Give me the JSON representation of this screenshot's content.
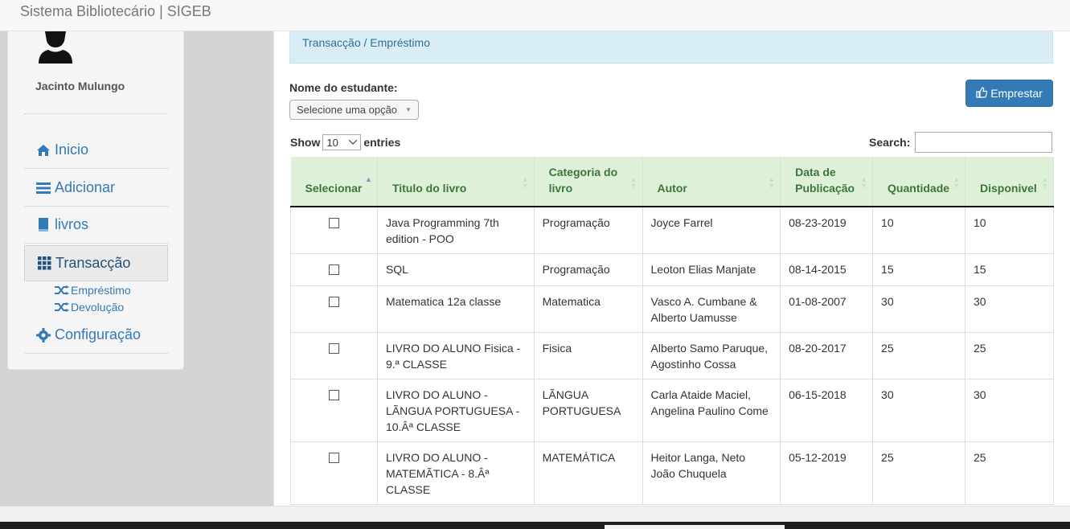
{
  "app": {
    "title": "Sistema Bibliotecário | SIGEB"
  },
  "sidebar": {
    "user_name": "Jacinto Mulungo",
    "items": [
      {
        "label": "Inicio",
        "icon": "home-icon"
      },
      {
        "label": "Adicionar",
        "icon": "list-icon"
      },
      {
        "label": "livros",
        "icon": "book-icon"
      },
      {
        "label": "Transacção",
        "icon": "grid-icon",
        "active": true
      },
      {
        "label": "Configuração",
        "icon": "gear-icon"
      }
    ],
    "sub_items": [
      {
        "label": "Empréstimo",
        "icon": "shuffle-icon"
      },
      {
        "label": "Devolução",
        "icon": "shuffle-icon"
      }
    ]
  },
  "breadcrumb": "Transacção / Empréstimo",
  "form": {
    "student_label": "Nome do estudante:",
    "student_placeholder": "Selecione uma opção",
    "lend_button": "Emprestar"
  },
  "table_controls": {
    "show_label": "Show",
    "entries_value": "10",
    "entries_label": "entries",
    "search_label": "Search:"
  },
  "table": {
    "headers": [
      "Selecionar",
      "Titulo do livro",
      "Categoria do livro",
      "Autor",
      "Data de Publicação",
      "Quantidade",
      "Disponivel"
    ],
    "rows": [
      {
        "title": "Java Programming 7th edition - POO",
        "category": "Programação",
        "author": "Joyce Farrel",
        "date": "08-23-2019",
        "quantity": "10",
        "available": "10"
      },
      {
        "title": "SQL",
        "category": "Programação",
        "author": "Leoton Elias Manjate",
        "date": "08-14-2015",
        "quantity": "15",
        "available": "15"
      },
      {
        "title": "Matematica 12a classe",
        "category": "Matematica",
        "author": "Vasco A. Cumbane & Alberto Uamusse",
        "date": "01-08-2007",
        "quantity": "30",
        "available": "30"
      },
      {
        "title": "LIVRO DO ALUNO Fisica - 9.ª CLASSE",
        "category": "Fisica",
        "author": "Alberto Samo Paruque, Agostinho Cossa",
        "date": "08-20-2017",
        "quantity": "25",
        "available": "25"
      },
      {
        "title": "LIVRO DO ALUNO - LÃNGUA PORTUGUESA - 10.Âª CLASSE",
        "category": "LÃNGUA PORTUGUESA",
        "author": "Carla Ataide Maciel, Angelina Paulino Come",
        "date": "06-15-2018",
        "quantity": "30",
        "available": "30"
      },
      {
        "title": "LIVRO DO ALUNO - MATEMÃTICA - 8.Âª CLASSE",
        "category": "MATEMÁTICA",
        "author": "Heitor Langa, Neto João  Chuquela",
        "date": "05-12-2019",
        "quantity": "25",
        "available": "25"
      }
    ]
  },
  "colors": {
    "primary": "#337ab7",
    "header_bg": "#dff0d8",
    "breadcrumb_bg": "#d9edf7"
  }
}
